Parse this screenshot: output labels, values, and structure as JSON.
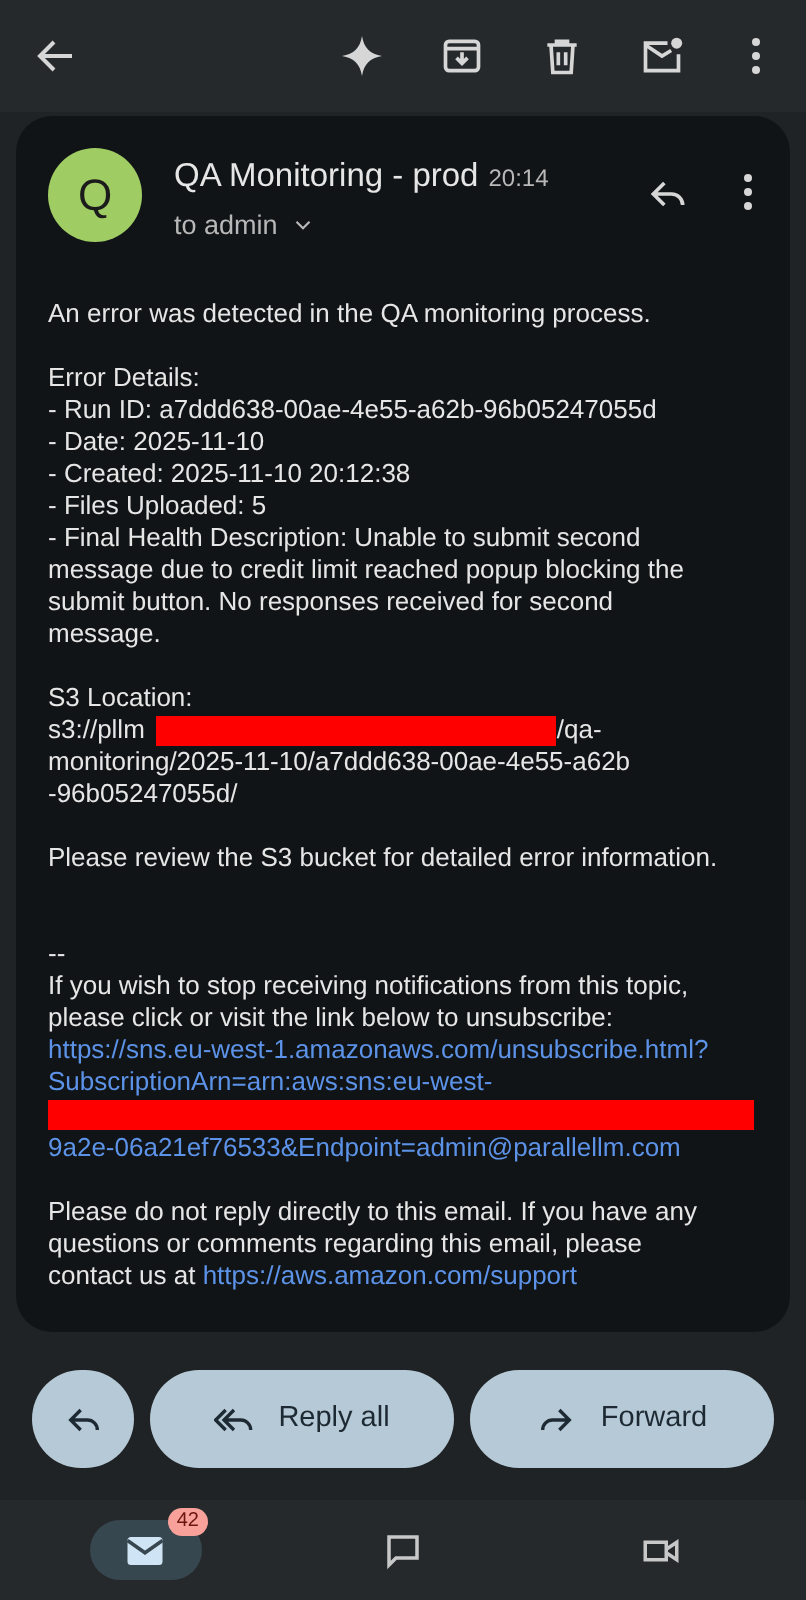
{
  "sender": {
    "initial": "Q",
    "name": "QA Monitoring - prod",
    "time": "20:14",
    "recipient": "to admin"
  },
  "body": {
    "intro": "An error was detected in the QA monitoring process.",
    "details": "Error Details:\n- Run ID: a7ddd638-00ae-4e55-a62b-96b05247055d\n- Date: 2025-11-10\n- Created: 2025-11-10 20:12:38\n- Files Uploaded: 5\n- Final Health Description: Unable to submit second\nmessage due to credit limit reached popup blocking the\nsubmit button. No responses received for second\nmessage.",
    "s3_label": "S3 Location:",
    "s3_prefix": "s3://pllm",
    "s3_suffix": "/qa-",
    "s3_rest": "monitoring/2025-11-10/a7ddd638-00ae-4e55-a62b\n-96b05247055d/",
    "review": "Please review the S3 bucket for detailed error information.",
    "signature": "--\nIf you wish to stop receiving notifications from this topic,\nplease click or visit the link below to unsubscribe:",
    "unsubscribe_link_start": "https://sns.eu-west-1.amazonaws.com/unsubscribe.html?\nSubscriptionArn=arn:aws:sns:eu-west-",
    "unsubscribe_link_end": "9a2e-06a21ef76533&Endpoint=admin@parallellm.com",
    "footer": "Please do not reply directly to this email. If you have any\nquestions or comments regarding this email, please\ncontact us at ",
    "support_link": "https://aws.amazon.com/support"
  },
  "actions": [
    {
      "kind": "reply"
    },
    {
      "kind": "reply_all",
      "label": "Reply all"
    },
    {
      "kind": "forward",
      "label": "Forward"
    }
  ],
  "nav": [
    {
      "kind": "mail",
      "badge": "42",
      "selected": true
    },
    {
      "kind": "chat",
      "selected": false
    },
    {
      "kind": "meet",
      "selected": false
    }
  ]
}
